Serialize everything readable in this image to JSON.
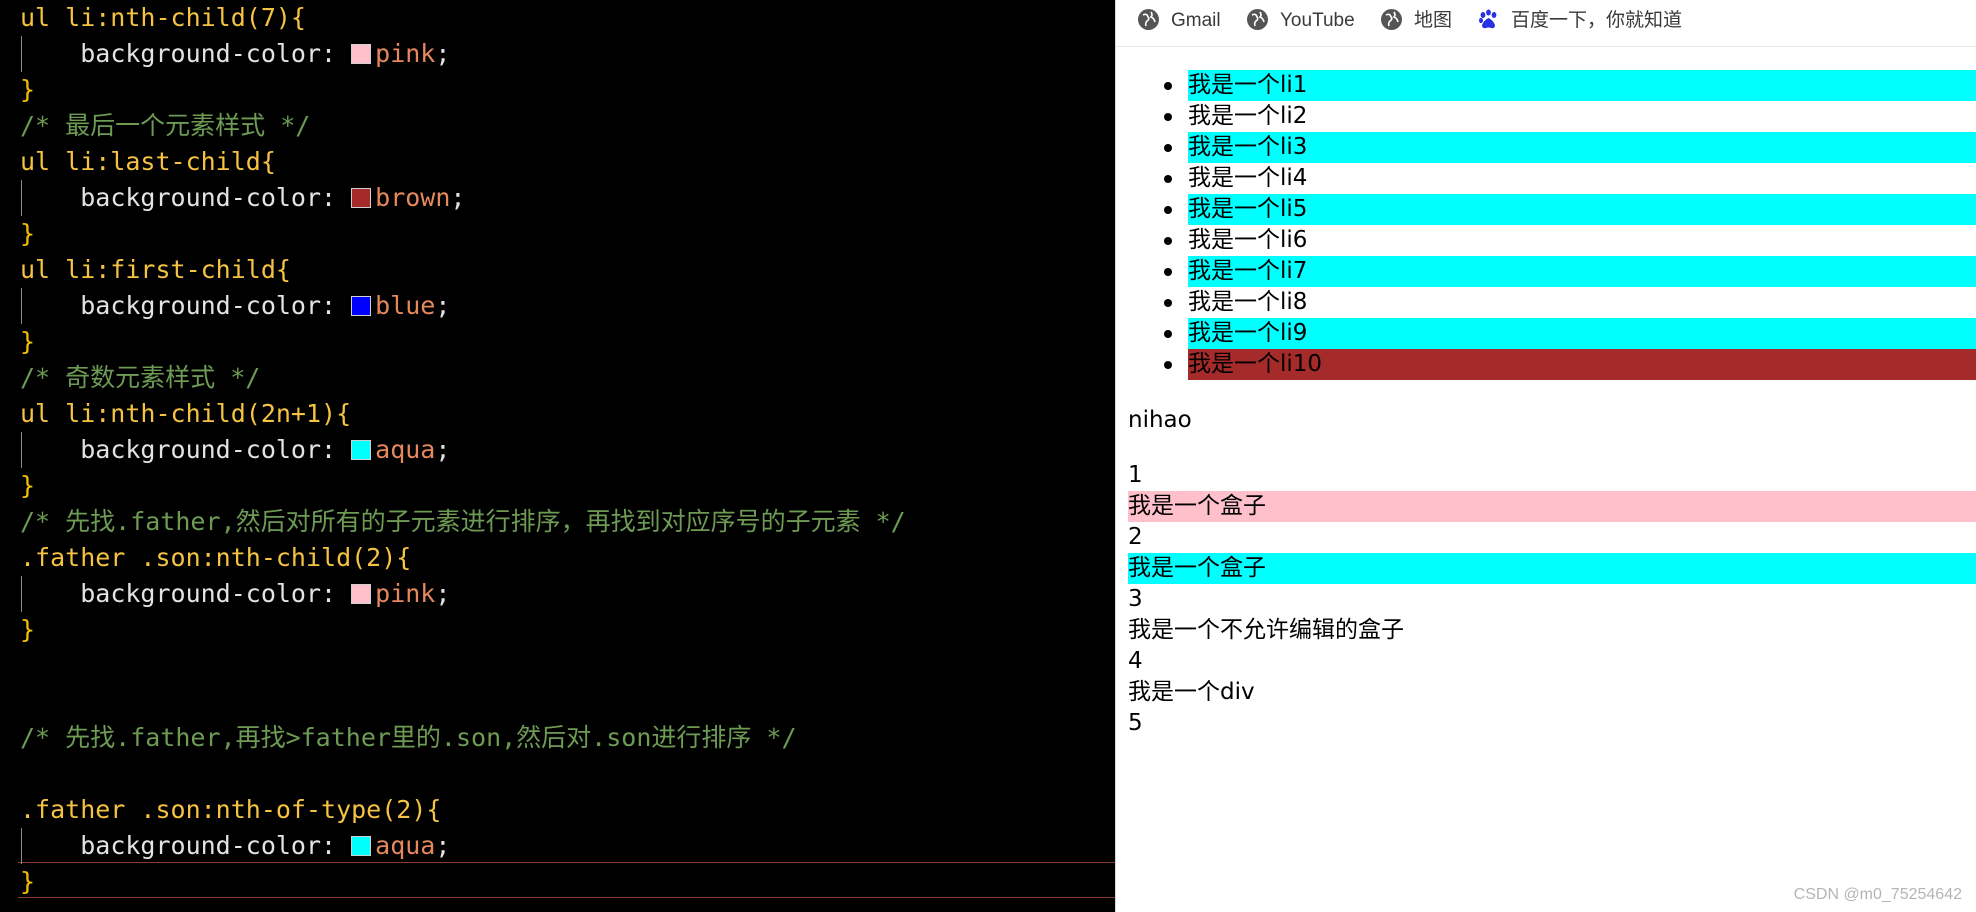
{
  "editor": {
    "lines": [
      {
        "kind": "selector",
        "text": "ul li:nth-child(7){"
      },
      {
        "kind": "decl",
        "prop": "background-color: ",
        "value": "pink",
        "swatch": "#ffc0cb"
      },
      {
        "kind": "brace",
        "text": "}"
      },
      {
        "kind": "comment",
        "text": "/* 最后一个元素样式 */"
      },
      {
        "kind": "selector",
        "text": "ul li:last-child{"
      },
      {
        "kind": "decl",
        "prop": "background-color: ",
        "value": "brown",
        "swatch": "#a52a2a"
      },
      {
        "kind": "brace",
        "text": "}"
      },
      {
        "kind": "selector",
        "text": "ul li:first-child{"
      },
      {
        "kind": "decl",
        "prop": "background-color: ",
        "value": "blue",
        "swatch": "#0000ff"
      },
      {
        "kind": "brace",
        "text": "}"
      },
      {
        "kind": "comment",
        "text": "/* 奇数元素样式 */"
      },
      {
        "kind": "selector",
        "text": "ul li:nth-child(2n+1){"
      },
      {
        "kind": "decl",
        "prop": "background-color: ",
        "value": "aqua",
        "swatch": "#00ffff"
      },
      {
        "kind": "brace",
        "text": "}"
      },
      {
        "kind": "comment",
        "text": "/* 先找.father,然后对所有的子元素进行排序，再找到对应序号的子元素 */"
      },
      {
        "kind": "selector",
        "text": ".father .son:nth-child(2){"
      },
      {
        "kind": "decl",
        "prop": "background-color: ",
        "value": "pink",
        "swatch": "#ffc0cb"
      },
      {
        "kind": "brace",
        "text": "}"
      },
      {
        "kind": "blank",
        "text": ""
      },
      {
        "kind": "blank",
        "text": ""
      },
      {
        "kind": "comment",
        "text": "/* 先找.father,再找>father里的.son,然后对.son进行排序 */"
      },
      {
        "kind": "blank",
        "text": ""
      },
      {
        "kind": "selector",
        "text": ".father .son:nth-of-type(2){"
      },
      {
        "kind": "decl",
        "prop": "background-color: ",
        "value": "aqua",
        "swatch": "#00ffff"
      },
      {
        "kind": "brace",
        "text": "}"
      }
    ],
    "colors": {
      "selector": "#f5c242",
      "value": "#e6885e",
      "comment": "#6d9b54",
      "brace": "#f0c000"
    }
  },
  "browser": {
    "bookmarks": [
      {
        "label": "Gmail",
        "icon": "globe-icon"
      },
      {
        "label": "YouTube",
        "icon": "globe-icon"
      },
      {
        "label": "地图",
        "icon": "globe-icon"
      },
      {
        "label": "百度一下，你就知道",
        "icon": "baidu-paw-icon"
      }
    ],
    "list_items": [
      {
        "text": "我是一个li1",
        "bg": "#00ffff"
      },
      {
        "text": "我是一个li2",
        "bg": ""
      },
      {
        "text": "我是一个li3",
        "bg": "#00ffff"
      },
      {
        "text": "我是一个li4",
        "bg": ""
      },
      {
        "text": "我是一个li5",
        "bg": "#00ffff"
      },
      {
        "text": "我是一个li6",
        "bg": ""
      },
      {
        "text": "我是一个li7",
        "bg": "#00ffff"
      },
      {
        "text": "我是一个li8",
        "bg": ""
      },
      {
        "text": "我是一个li9",
        "bg": "#00ffff"
      },
      {
        "text": "我是一个li10",
        "bg": "#a52a2a"
      }
    ],
    "paragraph": "nihao",
    "father_children": [
      {
        "text": "1",
        "bg": ""
      },
      {
        "text": "我是一个盒子",
        "bg": "#ffc0cb"
      },
      {
        "text": "2",
        "bg": ""
      },
      {
        "text": "我是一个盒子",
        "bg": "#00ffff"
      },
      {
        "text": "3",
        "bg": ""
      },
      {
        "text": "我是一个不允许编辑的盒子",
        "bg": ""
      },
      {
        "text": "4",
        "bg": ""
      },
      {
        "text": "我是一个div",
        "bg": ""
      },
      {
        "text": "5",
        "bg": ""
      }
    ],
    "watermark": "CSDN @m0_75254642"
  }
}
